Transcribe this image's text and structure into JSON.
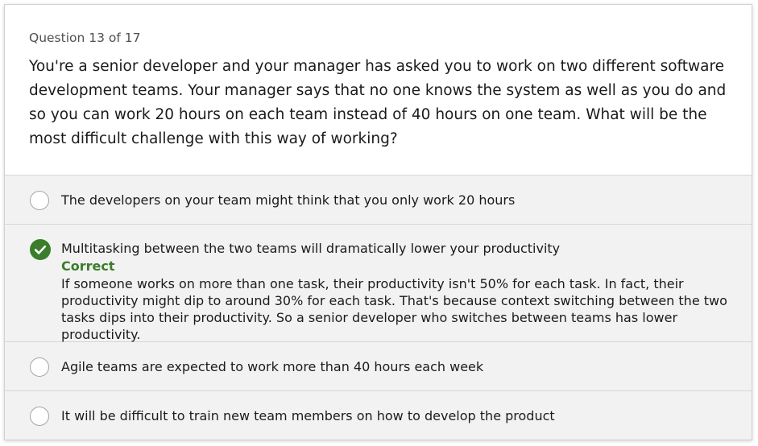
{
  "question": {
    "number_label": "Question 13 of 17",
    "text": "You're a senior developer and your manager has asked you to work on two different software development teams. Your manager says that no one knows the system as well as you do and so you can work 20 hours on each team instead of 40 hours on one team. What will be the most difficult challenge with this way of working?"
  },
  "options": [
    {
      "label": "The developers on your team might think that you only work 20 hours",
      "selected": false
    },
    {
      "label": "Multitasking between the two teams will dramatically lower your productivity",
      "selected": true,
      "status": "Correct",
      "explanation": "If someone works on more than one task, their productivity isn't 50% for each task. In fact, their productivity might dip to around 30% for each task. That's because context switching between the two tasks dips into their productivity. So a senior developer who switches between teams has lower productivity."
    },
    {
      "label": "Agile teams are expected to work more than 40 hours each week",
      "selected": false
    },
    {
      "label": "It will be difficult to train new team members on how to develop the product",
      "selected": false
    }
  ],
  "colors": {
    "correct_green": "#3a7d2a",
    "option_background": "#f2f2f2",
    "divider": "#d6d6d6"
  },
  "icons": {
    "selected_marker": "checkmark-circle-icon",
    "unselected_marker": "radio-empty-icon"
  }
}
